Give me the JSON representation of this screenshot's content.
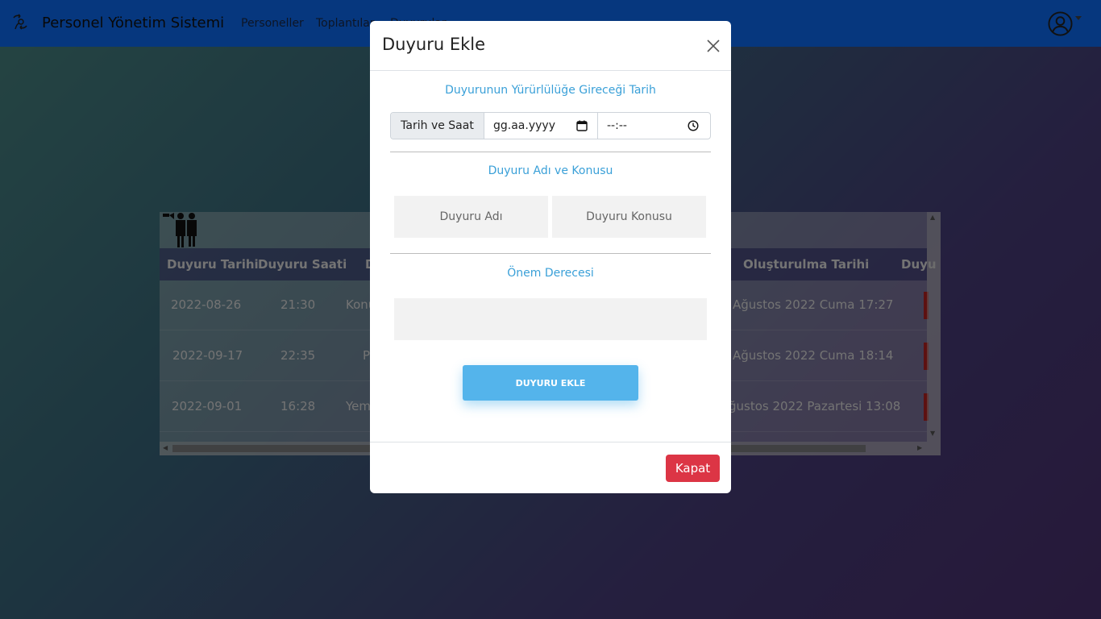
{
  "navbar": {
    "brand": "Personel Yönetim Sistemi",
    "links": [
      "Personeller",
      "Toplantılar",
      "Duyurular"
    ],
    "color": "#0d6efd"
  },
  "table": {
    "headers": [
      "Duyuru Tarihi",
      "Duyuru Saati",
      "D",
      "Oluşturulma Tarihi",
      "Duyu"
    ],
    "rows": [
      {
        "date": "2022-08-26",
        "time": "21:30",
        "name": "Konu",
        "created": "Ağustos 2022 Cuma 17:27"
      },
      {
        "date": "2022-09-17",
        "time": "22:35",
        "name": "P",
        "created": "Ağustos 2022 Cuma 18:14"
      },
      {
        "date": "2022-09-01",
        "time": "16:28",
        "name": "Yem",
        "created": "ğustos 2022 Pazartesi 13:08"
      }
    ]
  },
  "modal": {
    "title": "Duyuru Ekle",
    "section_date": "Duyurunun Yürürlülüğe Gireceği Tarih",
    "datetime_label": "Tarih ve Saat",
    "date_placeholder": "gg.aa.yyyy",
    "time_placeholder": "--:--",
    "section_name": "Duyuru Adı ve Konusu",
    "name_placeholder": "Duyuru Adı",
    "subject_placeholder": "Duyuru Konusu",
    "section_priority": "Önem Derecesi",
    "submit_label": "DUYURU EKLE",
    "close_label": "Kapat",
    "accent": "#3aa0d8",
    "danger": "#dc3545"
  }
}
